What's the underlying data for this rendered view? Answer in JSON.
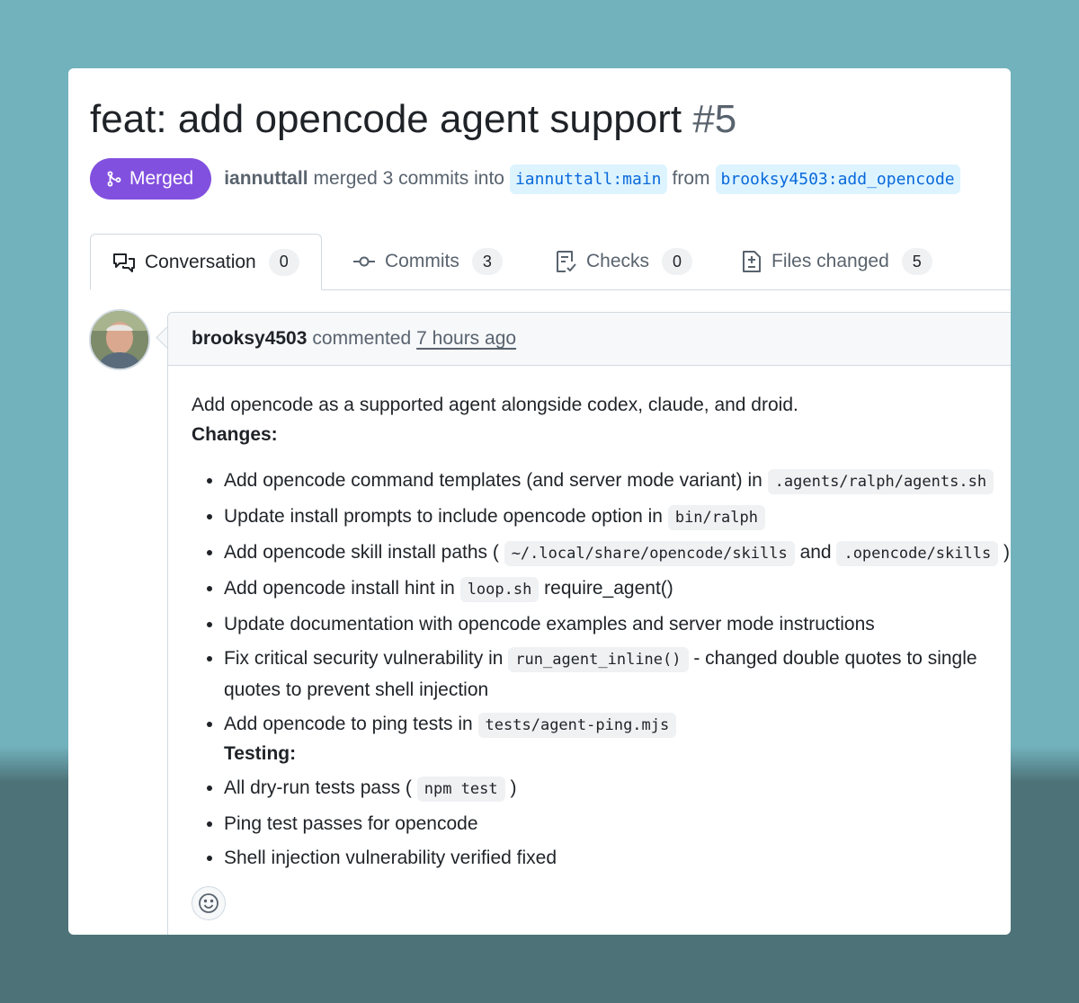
{
  "pr": {
    "title": "feat: add opencode agent support",
    "number": "#5",
    "status": "Merged",
    "merger": "iannuttall",
    "merge_text": "merged 3 commits into",
    "base_branch": "iannuttall:main",
    "from_text": "from",
    "head_branch": "brooksy4503:add_opencode"
  },
  "tabs": [
    {
      "label": "Conversation",
      "count": "0",
      "icon": "comment-discussion-icon"
    },
    {
      "label": "Commits",
      "count": "3",
      "icon": "git-commit-icon"
    },
    {
      "label": "Checks",
      "count": "0",
      "icon": "checklist-icon"
    },
    {
      "label": "Files changed",
      "count": "5",
      "icon": "file-diff-icon"
    }
  ],
  "comment": {
    "author": "brooksy4503",
    "action": "commented",
    "time": "7 hours ago",
    "intro": "Add opencode as a supported agent alongside codex, claude, and droid.",
    "changes_heading": "Changes:",
    "items": [
      {
        "pre": "Add opencode command templates (and server mode variant) in ",
        "code": ".agents/ralph/agents.sh",
        "post": ""
      },
      {
        "pre": "Update install prompts to include opencode option in ",
        "code": "bin/ralph",
        "post": ""
      },
      {
        "pre": "Add opencode skill install paths ( ",
        "code": "~/.local/share/opencode/skills",
        "mid": " and ",
        "code2": ".opencode/skills",
        "post": " )"
      },
      {
        "pre": "Add opencode install hint in ",
        "code": "loop.sh",
        "post": " require_agent()"
      },
      {
        "pre": "Update documentation with opencode examples and server mode instructions"
      },
      {
        "pre": "Fix critical security vulnerability in ",
        "code": "run_agent_inline()",
        "post": " - changed double quotes to single quotes to prevent shell injection"
      },
      {
        "pre": "Add opencode to ping tests in ",
        "code": "tests/agent-ping.mjs",
        "post": ""
      }
    ],
    "testing_heading": "Testing:",
    "testing_items": [
      {
        "pre": "All dry-run tests pass ( ",
        "code": "npm test",
        "post": " )"
      },
      {
        "pre": "Ping test passes for opencode"
      },
      {
        "pre": "Shell injection vulnerability verified fixed"
      }
    ]
  },
  "reactions": {
    "icon": "smiley-icon"
  },
  "colors": {
    "merged_badge": "#8250df",
    "branch_bg": "#ddf4ff",
    "branch_text": "#0969da",
    "background": "#72b2bd"
  }
}
